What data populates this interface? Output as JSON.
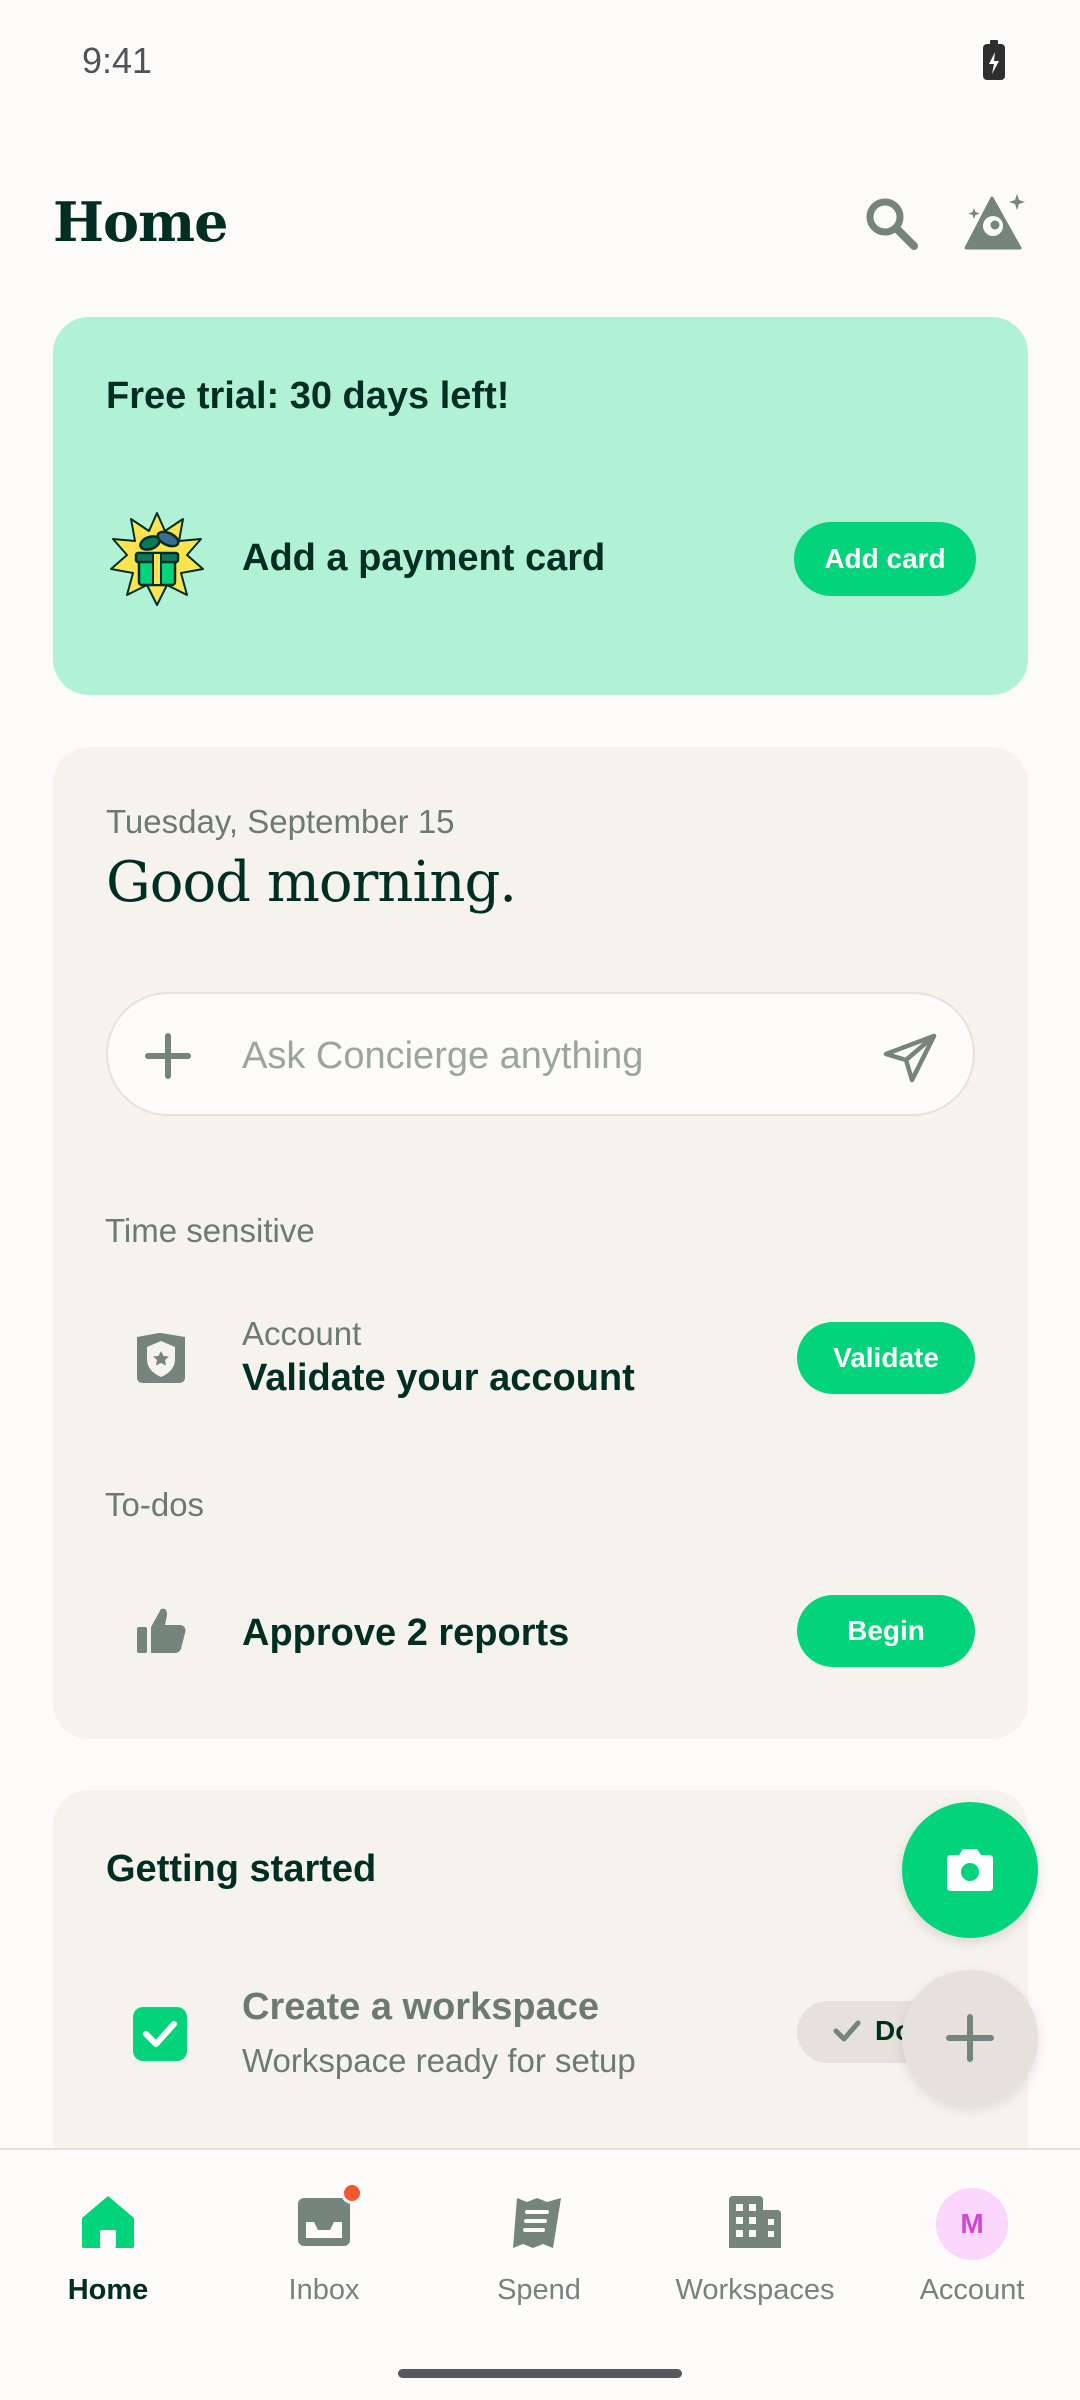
{
  "status_bar": {
    "time": "9:41"
  },
  "header": {
    "title": "Home"
  },
  "trial": {
    "title": "Free trial: 30 days left!",
    "label": "Add a payment card",
    "button": "Add card"
  },
  "home": {
    "date": "Tuesday, September 15",
    "greeting": "Good morning.",
    "composer": {
      "placeholder": "Ask Concierge anything"
    },
    "time_sensitive": {
      "label": "Time sensitive",
      "item": {
        "subtitle": "Account",
        "title": "Validate your account",
        "button": "Validate"
      }
    },
    "todos": {
      "label": "To-dos",
      "item": {
        "title": "Approve 2 reports",
        "button": "Begin"
      }
    }
  },
  "getting_started": {
    "title": "Getting started",
    "item": {
      "title": "Create a workspace",
      "subtitle": "Workspace ready for setup",
      "button": "Done"
    }
  },
  "bottom_nav": {
    "items": [
      {
        "label": "Home",
        "icon": "home-icon",
        "active": true
      },
      {
        "label": "Inbox",
        "icon": "inbox-icon",
        "active": false
      },
      {
        "label": "Spend",
        "icon": "receipt-icon",
        "active": false
      },
      {
        "label": "Workspaces",
        "icon": "building-icon",
        "active": false
      },
      {
        "label": "Account",
        "icon": "avatar",
        "active": false
      }
    ],
    "avatar_initial": "M"
  },
  "colors": {
    "primary_green": "#03D47C",
    "trial_bg": "#B1F2D6",
    "text_dark": "#002E22",
    "text_muted": "#6D7A74",
    "card_bg": "#F6F3EF",
    "badge_red": "#F25730"
  }
}
